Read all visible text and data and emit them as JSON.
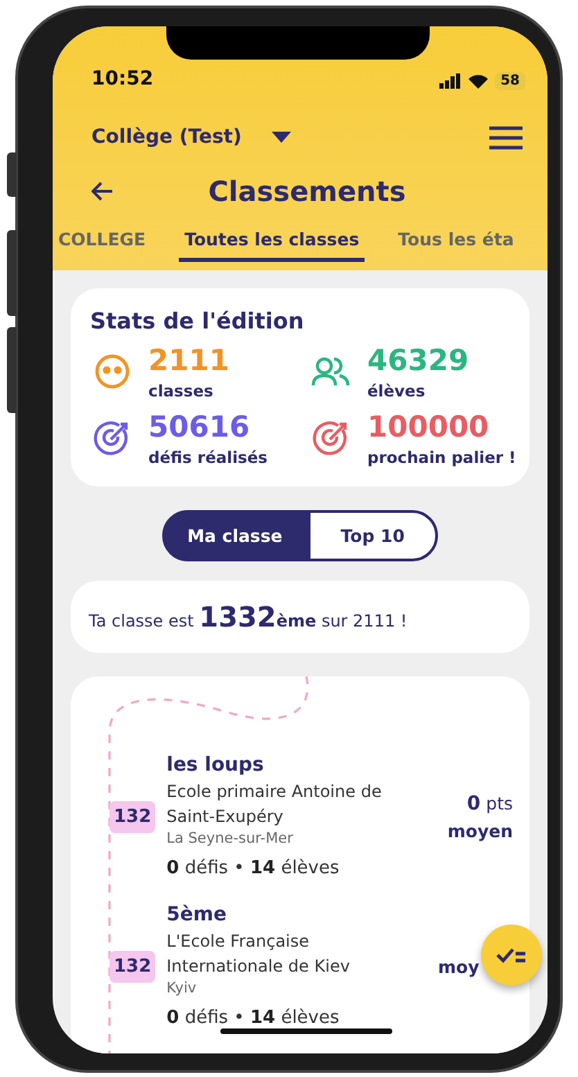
{
  "status_bar": {
    "time": "10:52",
    "battery": "58"
  },
  "header": {
    "school": "Collège (Test)",
    "title": "Classements"
  },
  "tabs": [
    {
      "label": "COLLEGE",
      "selected": false
    },
    {
      "label": "Toutes les classes",
      "selected": true
    },
    {
      "label": "Tous les éta",
      "selected": false
    }
  ],
  "stats": {
    "title": "Stats de l'édition",
    "items": [
      {
        "kind": "smiley",
        "value": "2111",
        "label": "classes",
        "color": "#f39324"
      },
      {
        "kind": "people",
        "value": "46329",
        "label": "élèves",
        "color": "#2bb67f"
      },
      {
        "kind": "target",
        "value": "50616",
        "label": "défis réalisés",
        "color": "#6c5ce7"
      },
      {
        "kind": "target",
        "value": "100000",
        "label": "prochain palier !",
        "color": "#e85d63"
      }
    ]
  },
  "segments": [
    {
      "label": "Ma classe",
      "selected": true
    },
    {
      "label": "Top 10",
      "selected": false
    }
  ],
  "rank_message": {
    "before": "Ta classe est",
    "rank": "1332",
    "after": "**ème** sur 2111 !"
  },
  "classes": [
    {
      "rank": "132",
      "name": "les loups",
      "school": "Ecole primaire Antoine de Saint-Exupéry",
      "city": "La Seyne-sur-Mer",
      "stats": "**0** défis • **14** élèves",
      "score": "**0** pts",
      "score_label": "moyen"
    },
    {
      "rank": "132",
      "name": "5ème",
      "school": "L'Ecole Française Internationale de Kiev",
      "city": "Kyiv",
      "stats": "**0** défis • **14** élèves",
      "score_label": "moy"
    }
  ]
}
